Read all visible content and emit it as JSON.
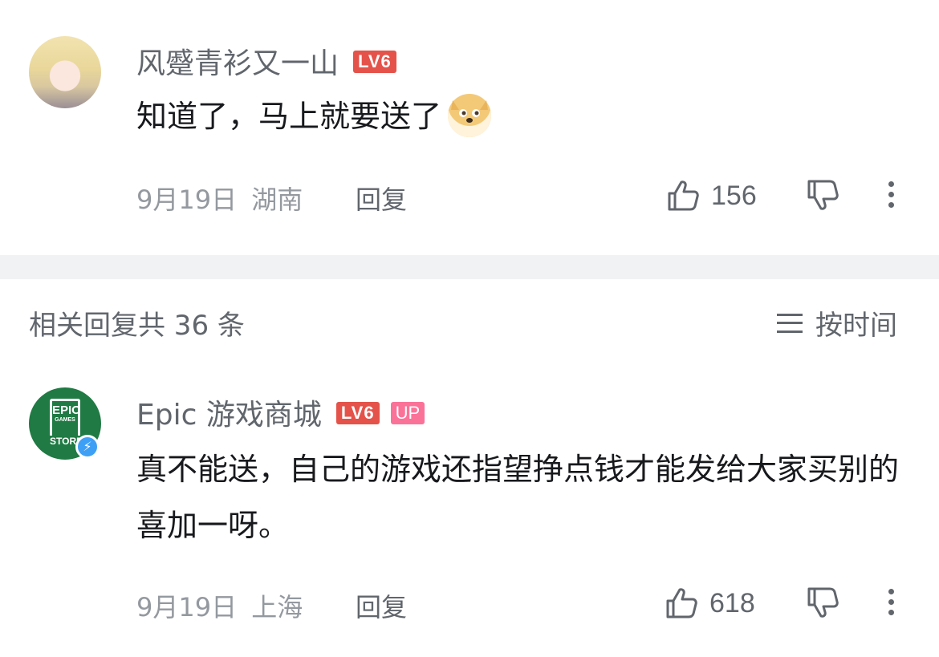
{
  "comments": [
    {
      "username": "风蹙青衫又一山",
      "level": "LV6",
      "text": "知道了，马上就要送了",
      "date": "9月19日",
      "location": "湖南",
      "reply_label": "回复",
      "likes": "156",
      "emoji": "doge-emoji"
    },
    {
      "username": "Epic 游戏商城",
      "level": "LV6",
      "up_badge": "UP",
      "avatar_text_top": "EPIC",
      "avatar_text_mid": "GAMES",
      "avatar_text_bottom": "STORE",
      "text": "真不能送，自己的游戏还指望挣点钱才能发给大家买别的喜加一呀。",
      "date": "9月19日",
      "location": "上海",
      "reply_label": "回复",
      "likes": "618"
    }
  ],
  "replies_header": {
    "title": "相关回复共 36 条",
    "sort_label": "按时间"
  },
  "colors": {
    "level_badge": "#e4524a",
    "up_badge": "#fb7299",
    "verify_badge": "#3ea0f5",
    "epic_green": "#1f7a43"
  }
}
